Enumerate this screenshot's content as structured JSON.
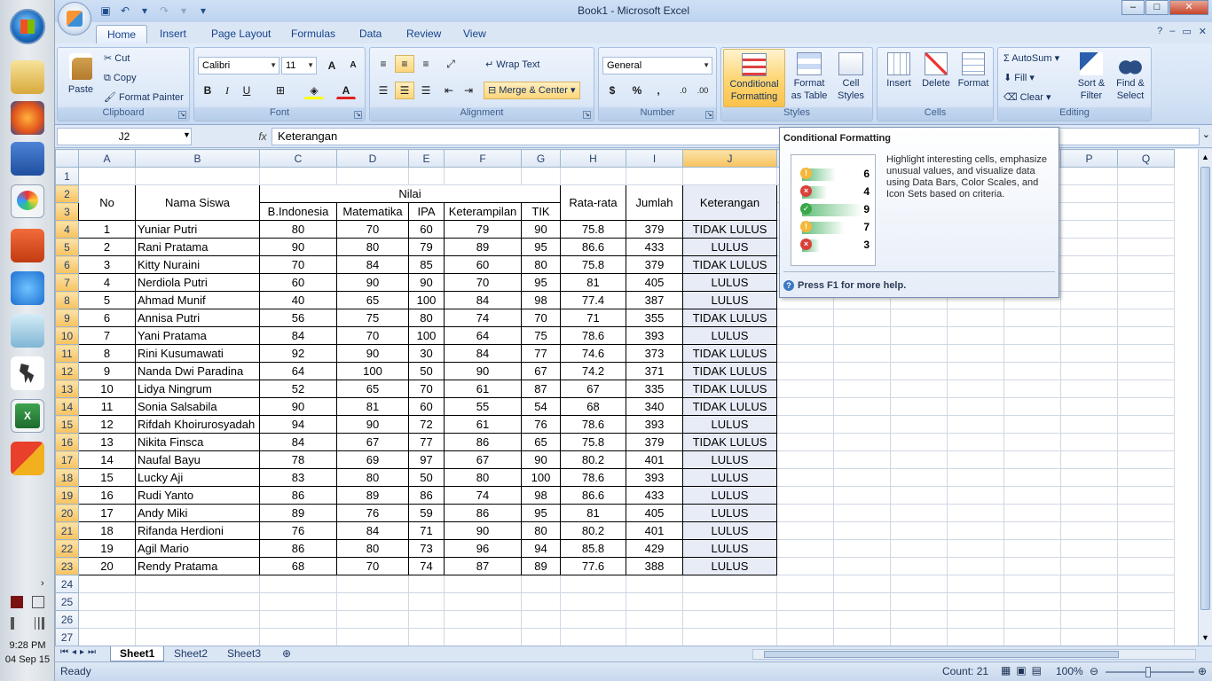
{
  "taskbar": {
    "time": "9:28 PM",
    "date": "04 Sep 15",
    "icons": [
      "explorer-icon",
      "firefox-icon",
      "word-icon",
      "paint-icon",
      "powerpoint-icon",
      "messenger-icon",
      "notepad-icon",
      "dinosaur-icon",
      "excel-icon",
      "avg-icon"
    ]
  },
  "window": {
    "title": "Book1 - Microsoft Excel",
    "min": "–",
    "max": "□",
    "close": "✕"
  },
  "ribbon_tabs": [
    "Home",
    "Insert",
    "Page Layout",
    "Formulas",
    "Data",
    "Review",
    "View"
  ],
  "ribbon": {
    "clipboard": {
      "label": "Clipboard",
      "paste": "Paste",
      "cut": "Cut",
      "copy": "Copy",
      "format_painter": "Format Painter"
    },
    "font": {
      "label": "Font",
      "name": "Calibri",
      "size": "11",
      "bold": "B",
      "italic": "I",
      "underline": "U"
    },
    "alignment": {
      "label": "Alignment",
      "wrap": "Wrap Text",
      "merge": "Merge & Center"
    },
    "number": {
      "label": "Number",
      "format": "General",
      "currency": "$",
      "percent": "%",
      "comma": ","
    },
    "styles": {
      "label": "Styles",
      "conditional": "Conditional Formatting",
      "as_table": "Format as Table",
      "cell_styles": "Cell Styles"
    },
    "cells": {
      "label": "Cells",
      "insert": "Insert",
      "delete": "Delete",
      "format": "Format"
    },
    "editing": {
      "label": "Editing",
      "autosum": "AutoSum",
      "fill": "Fill",
      "clear": "Clear",
      "sort": "Sort & Filter",
      "find": "Find & Select"
    }
  },
  "formula_bar": {
    "name_box": "J2",
    "fx": "fx",
    "value": "Keterangan"
  },
  "columns": [
    "A",
    "B",
    "C",
    "D",
    "E",
    "F",
    "G",
    "H",
    "I",
    "J",
    "K",
    "L",
    "M",
    "N",
    "O",
    "P",
    "Q"
  ],
  "headers": {
    "no": "No",
    "nama": "Nama Siswa",
    "nilai": "Nilai",
    "bindo": "B.Indonesia",
    "mat": "Matematika",
    "ipa": "IPA",
    "ket": "Keterampilan",
    "tik": "TIK",
    "rata": "Rata-rata",
    "jumlah": "Jumlah",
    "keterangan": "Keterangan"
  },
  "rows": [
    {
      "no": "1",
      "nama": "Yuniar Putri",
      "c": "80",
      "d": "70",
      "e": "60",
      "f": "79",
      "g": "90",
      "h": "75.8",
      "i": "379",
      "j": "TIDAK LULUS"
    },
    {
      "no": "2",
      "nama": "Rani Pratama",
      "c": "90",
      "d": "80",
      "e": "79",
      "f": "89",
      "g": "95",
      "h": "86.6",
      "i": "433",
      "j": "LULUS"
    },
    {
      "no": "3",
      "nama": "Kitty Nuraini",
      "c": "70",
      "d": "84",
      "e": "85",
      "f": "60",
      "g": "80",
      "h": "75.8",
      "i": "379",
      "j": "TIDAK LULUS"
    },
    {
      "no": "4",
      "nama": "Nerdiola Putri",
      "c": "60",
      "d": "90",
      "e": "90",
      "f": "70",
      "g": "95",
      "h": "81",
      "i": "405",
      "j": "LULUS"
    },
    {
      "no": "5",
      "nama": "Ahmad Munif",
      "c": "40",
      "d": "65",
      "e": "100",
      "f": "84",
      "g": "98",
      "h": "77.4",
      "i": "387",
      "j": "LULUS"
    },
    {
      "no": "6",
      "nama": "Annisa Putri",
      "c": "56",
      "d": "75",
      "e": "80",
      "f": "74",
      "g": "70",
      "h": "71",
      "i": "355",
      "j": "TIDAK LULUS"
    },
    {
      "no": "7",
      "nama": "Yani Pratama",
      "c": "84",
      "d": "70",
      "e": "100",
      "f": "64",
      "g": "75",
      "h": "78.6",
      "i": "393",
      "j": "LULUS"
    },
    {
      "no": "8",
      "nama": "Rini Kusumawati",
      "c": "92",
      "d": "90",
      "e": "30",
      "f": "84",
      "g": "77",
      "h": "74.6",
      "i": "373",
      "j": "TIDAK LULUS"
    },
    {
      "no": "9",
      "nama": "Nanda Dwi Paradina",
      "c": "64",
      "d": "100",
      "e": "50",
      "f": "90",
      "g": "67",
      "h": "74.2",
      "i": "371",
      "j": "TIDAK LULUS"
    },
    {
      "no": "10",
      "nama": "Lidya Ningrum",
      "c": "52",
      "d": "65",
      "e": "70",
      "f": "61",
      "g": "87",
      "h": "67",
      "i": "335",
      "j": "TIDAK LULUS"
    },
    {
      "no": "11",
      "nama": "Sonia Salsabila",
      "c": "90",
      "d": "81",
      "e": "60",
      "f": "55",
      "g": "54",
      "h": "68",
      "i": "340",
      "j": "TIDAK LULUS"
    },
    {
      "no": "12",
      "nama": "Rifdah Khoirurosyadah",
      "c": "94",
      "d": "90",
      "e": "72",
      "f": "61",
      "g": "76",
      "h": "78.6",
      "i": "393",
      "j": "LULUS"
    },
    {
      "no": "13",
      "nama": "Nikita Finsca",
      "c": "84",
      "d": "67",
      "e": "77",
      "f": "86",
      "g": "65",
      "h": "75.8",
      "i": "379",
      "j": "TIDAK LULUS"
    },
    {
      "no": "14",
      "nama": "Naufal Bayu",
      "c": "78",
      "d": "69",
      "e": "97",
      "f": "67",
      "g": "90",
      "h": "80.2",
      "i": "401",
      "j": "LULUS"
    },
    {
      "no": "15",
      "nama": "Lucky Aji",
      "c": "83",
      "d": "80",
      "e": "50",
      "f": "80",
      "g": "100",
      "h": "78.6",
      "i": "393",
      "j": "LULUS"
    },
    {
      "no": "16",
      "nama": "Rudi Yanto",
      "c": "86",
      "d": "89",
      "e": "86",
      "f": "74",
      "g": "98",
      "h": "86.6",
      "i": "433",
      "j": "LULUS"
    },
    {
      "no": "17",
      "nama": "Andy Miki",
      "c": "89",
      "d": "76",
      "e": "59",
      "f": "86",
      "g": "95",
      "h": "81",
      "i": "405",
      "j": "LULUS"
    },
    {
      "no": "18",
      "nama": "Rifanda Herdioni",
      "c": "76",
      "d": "84",
      "e": "71",
      "f": "90",
      "g": "80",
      "h": "80.2",
      "i": "401",
      "j": "LULUS"
    },
    {
      "no": "19",
      "nama": "Agil Mario",
      "c": "86",
      "d": "80",
      "e": "73",
      "f": "96",
      "g": "94",
      "h": "85.8",
      "i": "429",
      "j": "LULUS"
    },
    {
      "no": "20",
      "nama": "Rendy Pratama",
      "c": "68",
      "d": "70",
      "e": "74",
      "f": "87",
      "g": "89",
      "h": "77.6",
      "i": "388",
      "j": "LULUS"
    }
  ],
  "tooltip": {
    "title": "Conditional Formatting",
    "body": "Highlight interesting cells, emphasize unusual values, and visualize data using Data Bars, Color Scales, and Icon Sets based on criteria.",
    "help": "Press F1 for more help.",
    "sample_values": [
      "6",
      "4",
      "9",
      "7",
      "3"
    ]
  },
  "sheets": [
    "Sheet1",
    "Sheet2",
    "Sheet3"
  ],
  "status": {
    "ready": "Ready",
    "count": "Count: 21",
    "zoom": "100%"
  }
}
